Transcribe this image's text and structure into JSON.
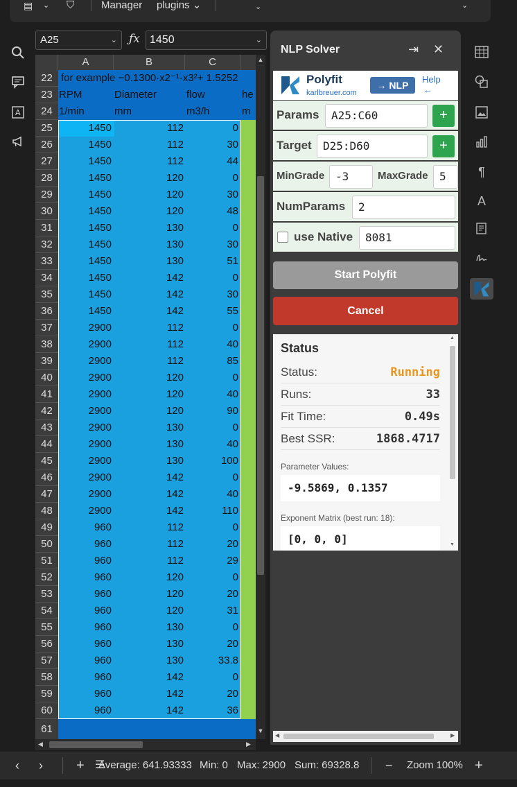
{
  "toolbar": {
    "manager": "Manager",
    "plugins": "plugins ⌄"
  },
  "formula_bar": {
    "name_box": "A25",
    "fx": "ƒx",
    "formula": "1450"
  },
  "columns": [
    "A",
    "B",
    "C"
  ],
  "header_rows": {
    "r22": {
      "num": "22",
      "text": "for example −0.1300·x2⁻¹·x3²+ 1.5252"
    },
    "r23": {
      "num": "23",
      "a": "RPM",
      "b": "Diameter",
      "c": "flow",
      "d": "he"
    },
    "r24": {
      "num": "24",
      "a": "1/min",
      "b": "mm",
      "c": "m3/h",
      "d": "m"
    }
  },
  "rows": [
    {
      "n": "25",
      "a": "1450",
      "b": "112",
      "c": "0"
    },
    {
      "n": "26",
      "a": "1450",
      "b": "112",
      "c": "30"
    },
    {
      "n": "27",
      "a": "1450",
      "b": "112",
      "c": "44"
    },
    {
      "n": "28",
      "a": "1450",
      "b": "120",
      "c": "0"
    },
    {
      "n": "29",
      "a": "1450",
      "b": "120",
      "c": "30"
    },
    {
      "n": "30",
      "a": "1450",
      "b": "120",
      "c": "48"
    },
    {
      "n": "31",
      "a": "1450",
      "b": "130",
      "c": "0"
    },
    {
      "n": "32",
      "a": "1450",
      "b": "130",
      "c": "30"
    },
    {
      "n": "33",
      "a": "1450",
      "b": "130",
      "c": "51"
    },
    {
      "n": "34",
      "a": "1450",
      "b": "142",
      "c": "0"
    },
    {
      "n": "35",
      "a": "1450",
      "b": "142",
      "c": "30"
    },
    {
      "n": "36",
      "a": "1450",
      "b": "142",
      "c": "55"
    },
    {
      "n": "37",
      "a": "2900",
      "b": "112",
      "c": "0"
    },
    {
      "n": "38",
      "a": "2900",
      "b": "112",
      "c": "40"
    },
    {
      "n": "39",
      "a": "2900",
      "b": "112",
      "c": "85"
    },
    {
      "n": "40",
      "a": "2900",
      "b": "120",
      "c": "0"
    },
    {
      "n": "41",
      "a": "2900",
      "b": "120",
      "c": "40"
    },
    {
      "n": "42",
      "a": "2900",
      "b": "120",
      "c": "90"
    },
    {
      "n": "43",
      "a": "2900",
      "b": "130",
      "c": "0"
    },
    {
      "n": "44",
      "a": "2900",
      "b": "130",
      "c": "40"
    },
    {
      "n": "45",
      "a": "2900",
      "b": "130",
      "c": "100"
    },
    {
      "n": "46",
      "a": "2900",
      "b": "142",
      "c": "0"
    },
    {
      "n": "47",
      "a": "2900",
      "b": "142",
      "c": "40"
    },
    {
      "n": "48",
      "a": "2900",
      "b": "142",
      "c": "110"
    },
    {
      "n": "49",
      "a": "960",
      "b": "112",
      "c": "0"
    },
    {
      "n": "50",
      "a": "960",
      "b": "112",
      "c": "20"
    },
    {
      "n": "51",
      "a": "960",
      "b": "112",
      "c": "29"
    },
    {
      "n": "52",
      "a": "960",
      "b": "120",
      "c": "0"
    },
    {
      "n": "53",
      "a": "960",
      "b": "120",
      "c": "20"
    },
    {
      "n": "54",
      "a": "960",
      "b": "120",
      "c": "31"
    },
    {
      "n": "55",
      "a": "960",
      "b": "130",
      "c": "0"
    },
    {
      "n": "56",
      "a": "960",
      "b": "130",
      "c": "20"
    },
    {
      "n": "57",
      "a": "960",
      "b": "130",
      "c": "33.8"
    },
    {
      "n": "58",
      "a": "960",
      "b": "142",
      "c": "0"
    },
    {
      "n": "59",
      "a": "960",
      "b": "142",
      "c": "20"
    },
    {
      "n": "60",
      "a": "960",
      "b": "142",
      "c": "36"
    }
  ],
  "last_row": "61",
  "panel": {
    "title": "NLP Solver",
    "brand": "Polyfit",
    "brand_site": "karlbreuer.com",
    "nlp_button": "→ NLP",
    "help": "Help",
    "help_arrow": "←",
    "params_label": "Params",
    "params_value": "A25:C60",
    "target_label": "Target",
    "target_value": "D25:D60",
    "plus": "+",
    "mingrade_label": "MinGrade",
    "mingrade_value": "-3",
    "maxgrade_label": "MaxGrade",
    "maxgrade_value": "5",
    "numparams_label": "NumParams",
    "numparams_value": "2",
    "native_label": "use Native",
    "native_value": "8081",
    "start_button": "Start Polyfit",
    "cancel_button": "Cancel"
  },
  "status": {
    "heading": "Status",
    "status_label": "Status:",
    "status_value": "Running",
    "runs_label": "Runs:",
    "runs_value": "33",
    "fit_label": "Fit Time:",
    "fit_value": "0.49s",
    "ssr_label": "Best SSR:",
    "ssr_value": "1868.4717",
    "params_heading": "Parameter Values:",
    "params_value": "-9.5869, 0.1357",
    "exp_heading": "Exponent Matrix (best run: 18):",
    "exp_value": "[0, 0, 0]"
  },
  "colors": {
    "running": "#e8961e",
    "selection": "#1aa0de",
    "header_blue": "#0a6cc4",
    "green_col": "#92d050",
    "cancel": "#c0392b",
    "plus": "#2ea44f"
  },
  "statusbar": {
    "average": "Average: 641.93333",
    "min": "Min: 0",
    "max": "Max: 2900",
    "sum": "Sum: 69328.8",
    "zoom": "Zoom 100%"
  }
}
